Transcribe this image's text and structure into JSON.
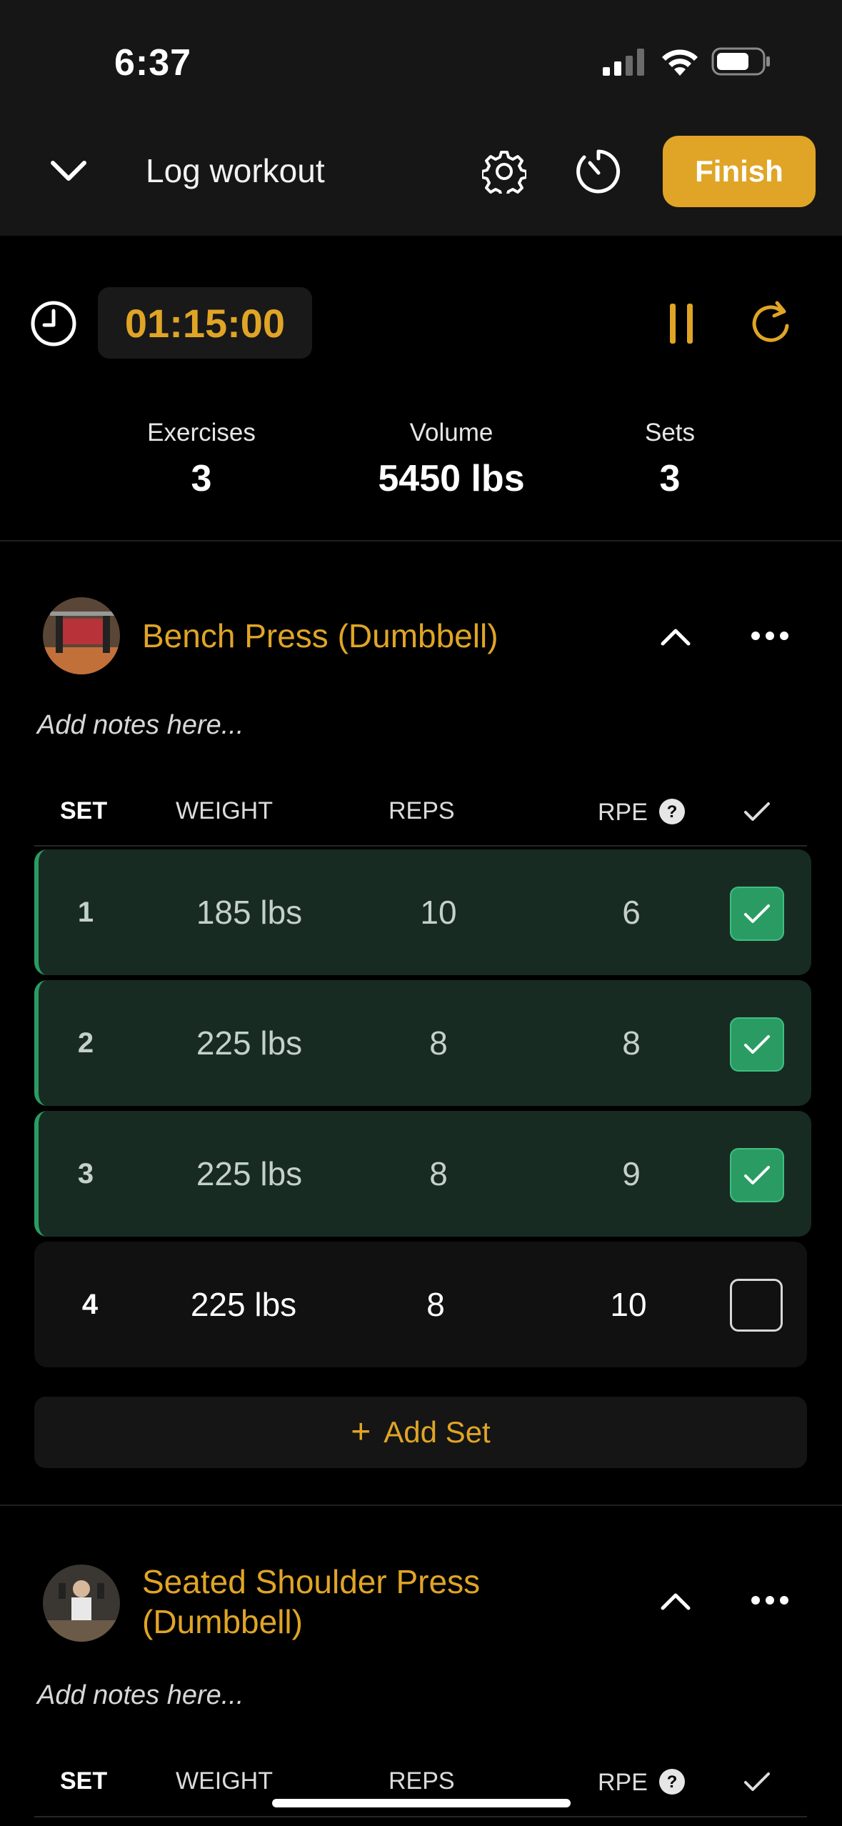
{
  "status_bar": {
    "time": "6:37"
  },
  "header": {
    "title": "Log workout",
    "finish_label": "Finish"
  },
  "timer": {
    "value": "01:15:00"
  },
  "stats": [
    {
      "label": "Exercises",
      "value": "3"
    },
    {
      "label": "Volume",
      "value": "5450 lbs"
    },
    {
      "label": "Sets",
      "value": "3"
    }
  ],
  "table_headers": {
    "set": "SET",
    "weight": "WEIGHT",
    "reps": "REPS",
    "rpe": "RPE"
  },
  "exercises": [
    {
      "name": "Bench Press (Dumbbell)",
      "notes_placeholder": "Add notes here...",
      "sets": [
        {
          "set": "1",
          "weight": "185 lbs",
          "reps": "10",
          "rpe": "6",
          "completed": true
        },
        {
          "set": "2",
          "weight": "225 lbs",
          "reps": "8",
          "rpe": "8",
          "completed": true
        },
        {
          "set": "3",
          "weight": "225 lbs",
          "reps": "8",
          "rpe": "9",
          "completed": true
        },
        {
          "set": "4",
          "weight": "225 lbs",
          "reps": "8",
          "rpe": "10",
          "completed": false
        }
      ],
      "add_set_label": "Add Set"
    },
    {
      "name_line1": "Seated Shoulder Press",
      "name_line2": "(Dumbbell)",
      "notes_placeholder": "Add notes here..."
    }
  ],
  "colors": {
    "accent": "#e0a526",
    "completed_row": "#172b23",
    "check_green": "#2a9c63"
  }
}
